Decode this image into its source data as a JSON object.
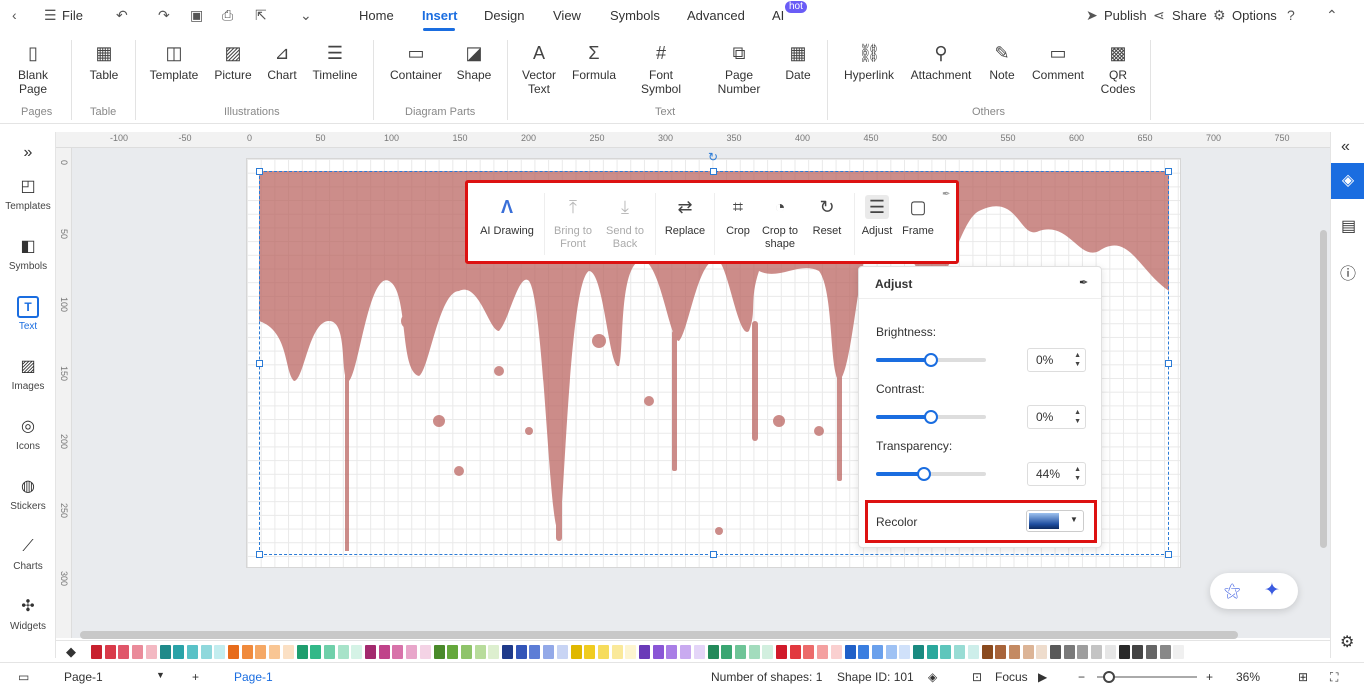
{
  "menu": {
    "file": "File",
    "tabs": [
      "Home",
      "Insert",
      "Design",
      "View",
      "Symbols",
      "Advanced",
      "AI"
    ],
    "ai_badge": "hot",
    "publish": "Publish",
    "share": "Share",
    "options": "Options"
  },
  "ribbon": {
    "blank_page": "Blank Page",
    "table": "Table",
    "template": "Template",
    "picture": "Picture",
    "chart": "Chart",
    "timeline": "Timeline",
    "container": "Container",
    "shape": "Shape",
    "vector_text": "Vector Text",
    "formula": "Formula",
    "font_symbol": "Font Symbol",
    "page_number": "Page Number",
    "date": "Date",
    "hyperlink": "Hyperlink",
    "attachment": "Attachment",
    "note": "Note",
    "comment": "Comment",
    "qr_codes": "QR Codes",
    "groups": [
      "Pages",
      "Table",
      "Illustrations",
      "Diagram Parts",
      "Text",
      "Others"
    ]
  },
  "sidebar": [
    "Templates",
    "Symbols",
    "Text",
    "Images",
    "Icons",
    "Stickers",
    "Charts",
    "Widgets"
  ],
  "ruler": {
    "h": [
      "-100",
      "-50",
      "0",
      "50",
      "100",
      "150",
      "200",
      "250",
      "300",
      "350",
      "400",
      "450",
      "500",
      "550",
      "600",
      "650",
      "700",
      "750"
    ],
    "v": [
      "0",
      "50",
      "100",
      "150",
      "200",
      "250",
      "300"
    ]
  },
  "float_toolbar": {
    "ai_drawing": "AI Drawing",
    "bring_front": "Bring to Front",
    "send_back": "Send to Back",
    "replace": "Replace",
    "crop": "Crop",
    "crop_shape": "Crop to shape",
    "reset": "Reset",
    "adjust": "Adjust",
    "frame": "Frame"
  },
  "adjust": {
    "title": "Adjust",
    "brightness": {
      "label": "Brightness:",
      "value": "0%",
      "level": 0.5
    },
    "contrast": {
      "label": "Contrast:",
      "value": "0%",
      "level": 0.5
    },
    "transparency": {
      "label": "Transparency:",
      "value": "44%",
      "level": 0.44
    },
    "recolor": "Recolor"
  },
  "palette": [
    "#c8202e",
    "#d93a4a",
    "#e0566a",
    "#ea8b9a",
    "#f3b8c2",
    "#1f8a8a",
    "#2aa3a8",
    "#59c2c7",
    "#8fd8dc",
    "#c3edef",
    "#e76b1a",
    "#f08a3c",
    "#f5a865",
    "#f9c694",
    "#fbe0c4",
    "#1f9e6e",
    "#32b888",
    "#6fd0aa",
    "#a7e3c9",
    "#d5f3e6",
    "#a32a6e",
    "#c0438a",
    "#d873aa",
    "#e8a6ca",
    "#f4d3e5",
    "#4a8a2a",
    "#65a83c",
    "#8fc46a",
    "#b8dc9c",
    "#ddefcf",
    "#1f3a8a",
    "#3355b8",
    "#5d7dd6",
    "#93a9e8",
    "#c8d4f4",
    "#e0b800",
    "#f0cc20",
    "#f6dc5c",
    "#fae99a",
    "#fdf5d0",
    "#6a3ab8",
    "#8a56d6",
    "#a97ee6",
    "#c9aaf0",
    "#e4d5f8",
    "#238a5a",
    "#3aa672",
    "#6ec497",
    "#a3dcbd",
    "#d2efdf",
    "#d11a2a",
    "#e2393f",
    "#ec6b6b",
    "#f4a0a0",
    "#fad0d0",
    "#2060c8",
    "#3a7ee0",
    "#6aa0ec",
    "#9fc2f4",
    "#d0e1fa",
    "#1a8a80",
    "#2aa89c",
    "#5ec6bc",
    "#98dcd4",
    "#cdeeea",
    "#8a4a1e",
    "#a8643a",
    "#c48a62",
    "#dcb496",
    "#eedccc",
    "#5a5a5a",
    "#7a7a7a",
    "#9e9e9e",
    "#c4c4c4",
    "#e6e6e6",
    "#2a2a2a",
    "#444444",
    "#666666",
    "#888888",
    "#f0f0f0"
  ],
  "status": {
    "page_select": "Page-1",
    "page_tab": "Page-1",
    "shapes": "Number of shapes: 1",
    "shape_id": "Shape ID: 101",
    "focus": "Focus",
    "zoom": "36%"
  }
}
